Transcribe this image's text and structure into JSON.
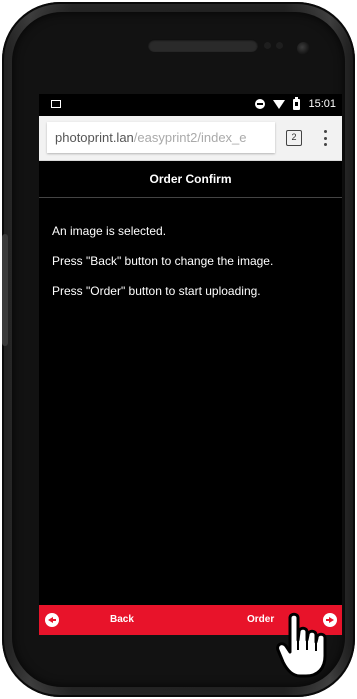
{
  "status_bar": {
    "time": "15:01"
  },
  "browser": {
    "url_host": "photoprint.lan",
    "url_path": "/easyprint2/index_e",
    "tab_count": "2"
  },
  "page": {
    "title": "Order Confirm",
    "messages": [
      "An image is selected.",
      "Press \"Back\" button to change the image.",
      "Press \"Order\" button to start uploading."
    ]
  },
  "footer": {
    "back_label": "Back",
    "order_label": "Order"
  },
  "colors": {
    "accent_red": "#e8132a",
    "screen_background": "#000000",
    "browser_bar": "#f2f2f2"
  },
  "icons": [
    "image-icon",
    "dnd-icon",
    "wifi-icon",
    "battery-icon",
    "tab-count-icon",
    "menu-icon",
    "arrow-left-icon",
    "arrow-right-icon",
    "hand-pointer-icon"
  ]
}
